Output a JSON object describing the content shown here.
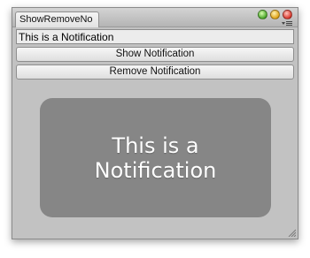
{
  "window": {
    "tab_title": "ShowRemoveNo",
    "icons": {
      "traffic_lights": [
        "green",
        "yellow",
        "red"
      ],
      "menu": "dropdown-menu-icon",
      "resize": "resize-grip-icon"
    },
    "colors": {
      "light_green": "#4aa629",
      "light_yellow": "#e0a316",
      "light_red": "#d9372c"
    }
  },
  "notification_input": {
    "value": "This is a Notification"
  },
  "buttons": {
    "show_label": "Show Notification",
    "remove_label": "Remove Notification"
  },
  "notification": {
    "text": "This is a Notification",
    "background": "#868686"
  }
}
